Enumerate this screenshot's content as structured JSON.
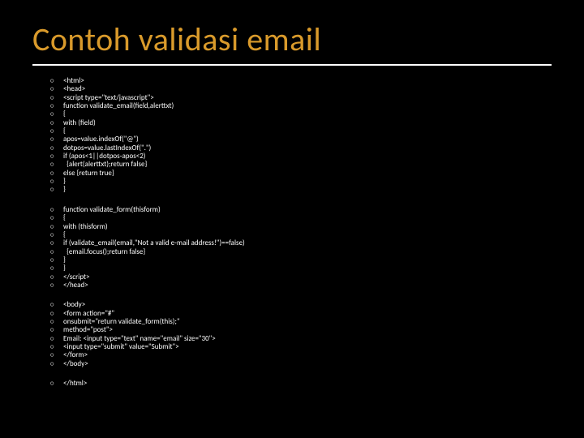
{
  "title": "Contoh validasi email",
  "blocks": [
    [
      "<html>",
      "<head>",
      "<script type=\"text/javascript\">",
      "function validate_email(field,alerttxt)",
      "{",
      "with (field)",
      "{",
      "apos=value.indexOf(\"@\")",
      "dotpos=value.lastIndexOf(\".\")",
      "if (apos<1||dotpos-apos<2)",
      "  {alert(alerttxt);return false}",
      "else {return true}",
      "}",
      "}"
    ],
    [
      "function validate_form(thisform)",
      "{",
      "with (thisform)",
      "{",
      "if (validate_email(email,\"Not a valid e-mail address!\")==false)",
      "  {email.focus();return false}",
      "}",
      "}",
      "</script>",
      "</head>"
    ],
    [
      "<body>",
      "<form action=\"#\"",
      "onsubmit=\"return validate_form(this);\"",
      "method=\"post\">",
      "Email: <input type=\"text\" name=\"email\" size=\"30\">",
      "<input type=\"submit\" value=\"Submit\">",
      "</form>",
      "</body>"
    ],
    [
      "</html>"
    ]
  ]
}
